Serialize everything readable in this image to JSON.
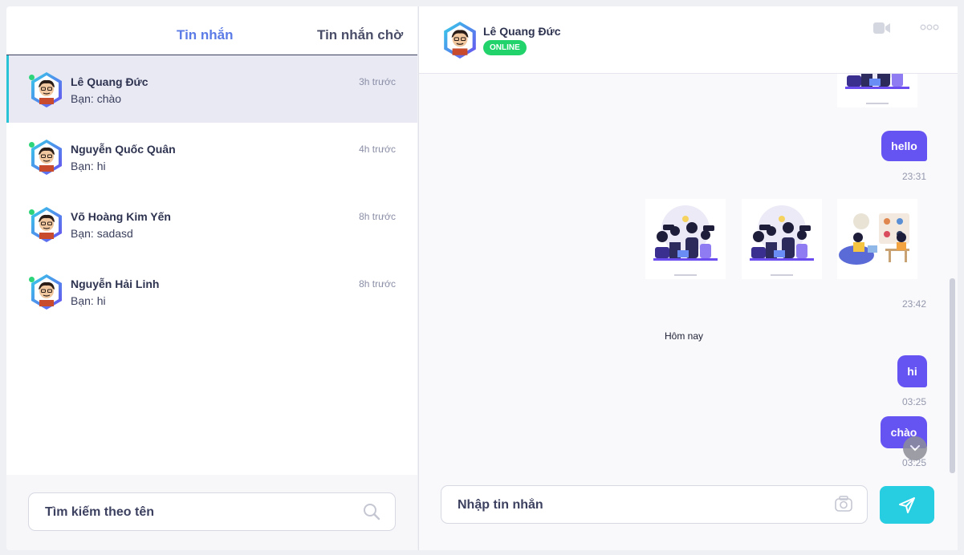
{
  "tabs": {
    "messages": "Tin nhắn",
    "pending": "Tin nhắn chờ"
  },
  "conversations": [
    {
      "name": "Lê Quang Đức",
      "preview": "Bạn: chào",
      "time": "3h trước"
    },
    {
      "name": "Nguyễn Quốc Quân",
      "preview": "Bạn: hi",
      "time": "4h trước"
    },
    {
      "name": "Võ Hoàng Kim Yến",
      "preview": "Bạn: sadasd",
      "time": "8h trước"
    },
    {
      "name": "Nguyễn Hải Linh",
      "preview": "Bạn: hi",
      "time": "8h trước"
    }
  ],
  "search": {
    "placeholder": "Tìm kiếm theo tên"
  },
  "chat": {
    "contact_name": "Lê Quang Đức",
    "status": "ONLINE",
    "messages": [
      {
        "type": "text",
        "text": "hello",
        "time": "23:31"
      },
      {
        "type": "images",
        "time": "23:42"
      },
      {
        "type": "divider",
        "text": "Hôm nay"
      },
      {
        "type": "text",
        "text": "hi",
        "time": "03:25"
      },
      {
        "type": "text",
        "text": "chào",
        "time": "03:25"
      }
    ],
    "composer_placeholder": "Nhập tin nhắn"
  },
  "colors": {
    "accent": "#5b7be6",
    "bubble": "#6553f2",
    "online": "#22d36b",
    "send": "#27cde0",
    "selected_indicator": "#28c3d4"
  },
  "icons": [
    "search-icon",
    "video-camera-icon",
    "more-icon",
    "camera-icon",
    "send-icon",
    "chevron-down-icon",
    "user-avatar-icon"
  ]
}
